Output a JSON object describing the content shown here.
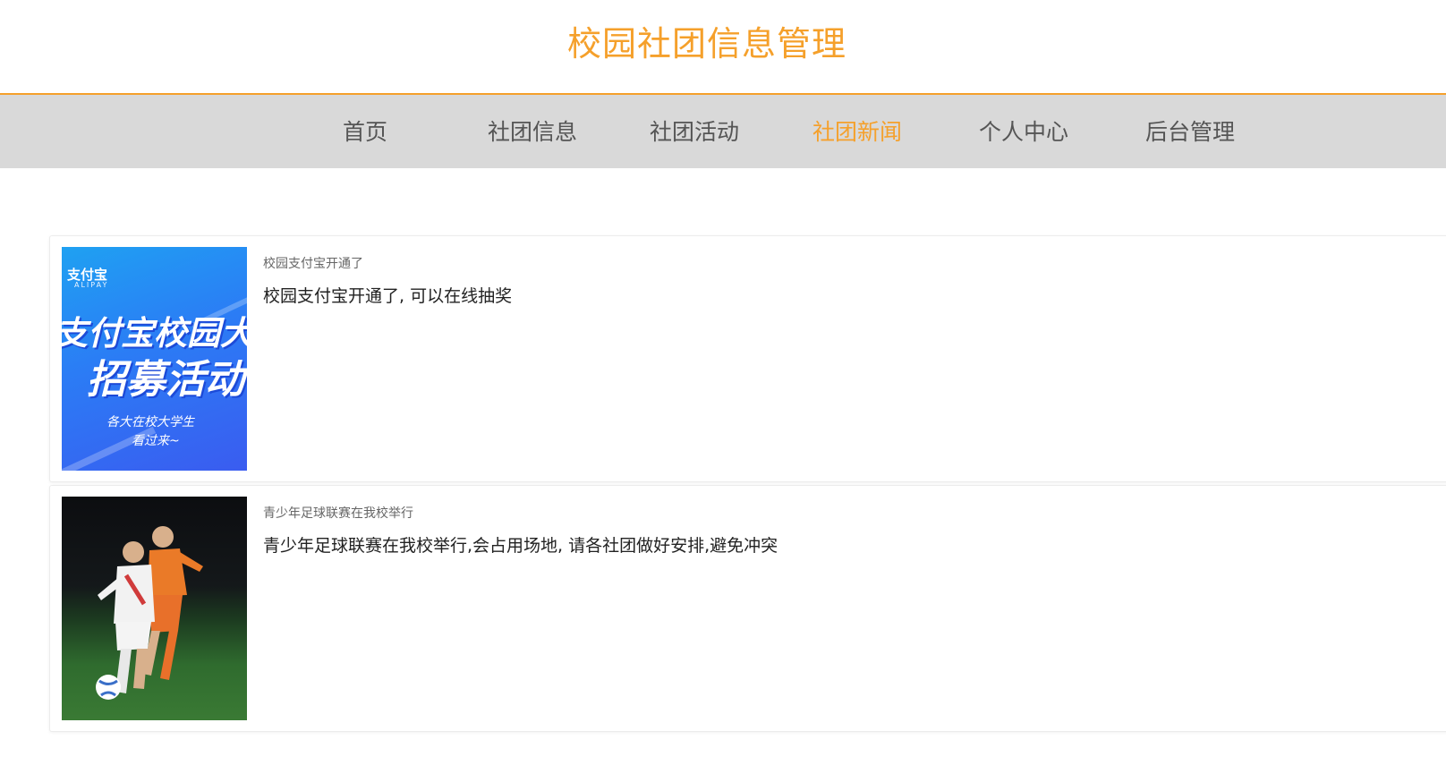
{
  "site": {
    "title": "校园社团信息管理"
  },
  "nav": {
    "items": [
      {
        "label": "首页"
      },
      {
        "label": "社团信息"
      },
      {
        "label": "社团活动"
      },
      {
        "label": "社团新闻"
      },
      {
        "label": "个人中心"
      },
      {
        "label": "后台管理"
      }
    ],
    "active_index": 3
  },
  "news": [
    {
      "title": "校园支付宝开通了",
      "content": "校园支付宝开通了, 可以在线抽奖",
      "image": {
        "brand": "支付宝",
        "brand_sub": "ALIPAY",
        "line1": "支付宝校园大使",
        "line2": "招募活动",
        "line3": "各大在校大学生",
        "line4": "看过来~"
      }
    },
    {
      "title": "青少年足球联赛在我校举行",
      "content": "青少年足球联赛在我校举行,会占用场地, 请各社团做好安排,避免冲突"
    }
  ],
  "colors": {
    "accent": "#f5a02b",
    "nav_bg": "#d9d9d9"
  }
}
